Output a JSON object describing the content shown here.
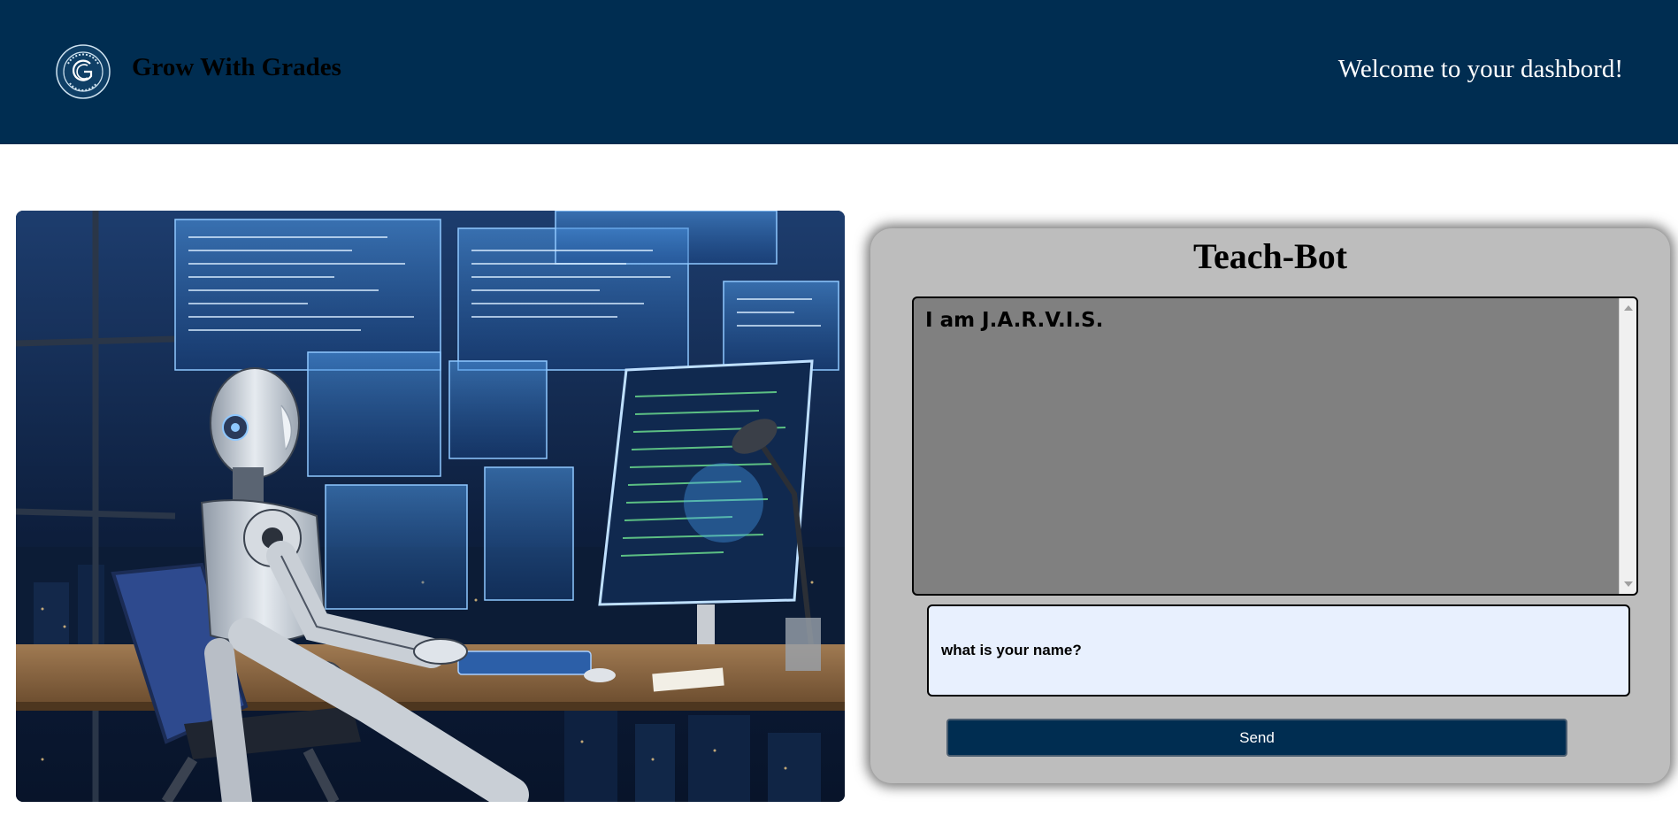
{
  "header": {
    "brand": "Grow With Grades",
    "welcome": "Welcome to your dashbord!",
    "logo": {
      "icon": "graduation-seal-logo",
      "ring_text": "GROW WITH GRADES · TEACH · BOT"
    }
  },
  "hero": {
    "illustration": "robot-at-desk-with-holographic-screens",
    "alt": "Humanoid robot seated at a desk in front of holographic code screens and a night city skyline"
  },
  "chatbot": {
    "title": "Teach-Bot",
    "messages": [
      "I am J.A.R.V.I.S."
    ],
    "input": {
      "value": "what is your name?",
      "placeholder": ""
    },
    "send_label": "Send"
  },
  "colors": {
    "header_bg": "#002d51",
    "panel_bg": "#bdbdbd",
    "chat_log_bg": "#808080",
    "input_bg": "#e8f0fe",
    "button_bg": "#002d51"
  }
}
